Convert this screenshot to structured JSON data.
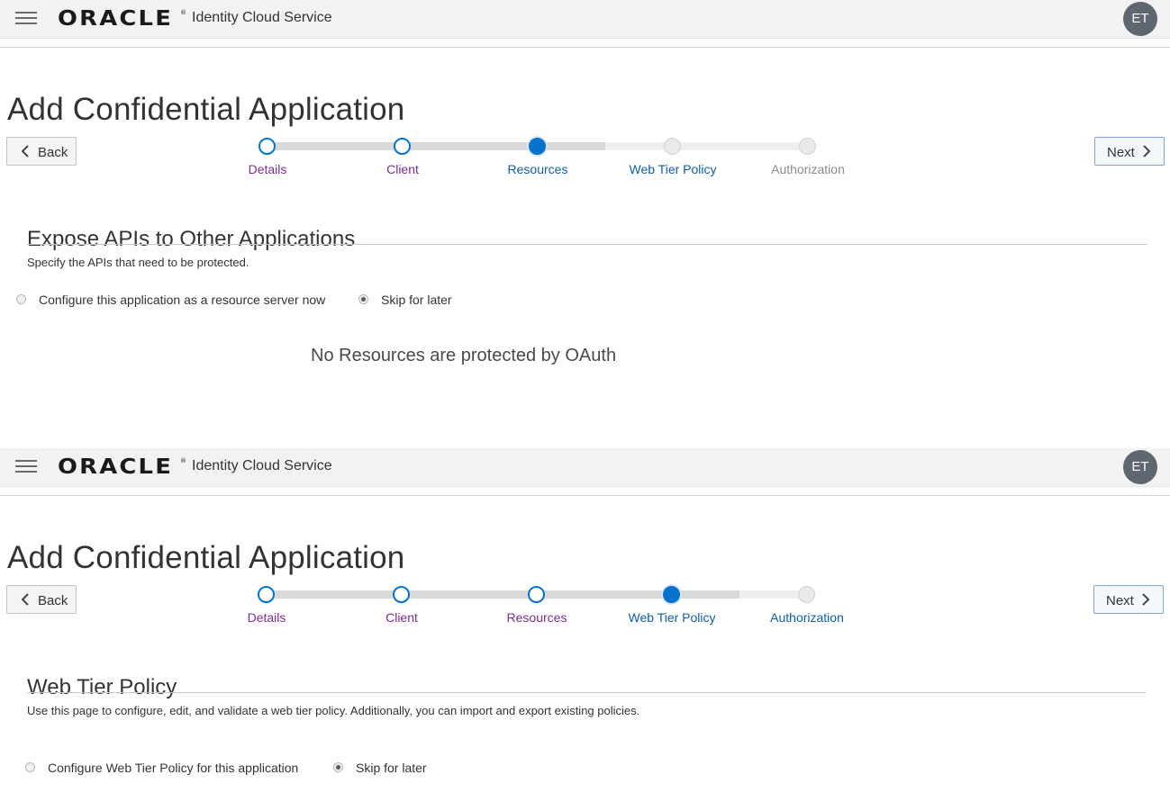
{
  "header": {
    "brand_logo_text": "ORACLE",
    "brand_reg_mark": "®",
    "product_name": "Identity Cloud Service",
    "user_initials": "ET"
  },
  "panels": [
    {
      "page_title": "Add Confidential Application",
      "back_label": "Back",
      "next_label": "Next",
      "train": {
        "steps": [
          {
            "label": "Details",
            "state": "visited"
          },
          {
            "label": "Client",
            "state": "visited"
          },
          {
            "label": "Resources",
            "state": "current"
          },
          {
            "label": "Web Tier Policy",
            "state": "pending"
          },
          {
            "label": "Authorization",
            "state": "pending"
          }
        ]
      },
      "section_title": "Expose APIs to Other Applications",
      "section_description": "Specify the APIs that need to be protected.",
      "options": [
        {
          "label": "Configure this application as a resource server now",
          "selected": false
        },
        {
          "label": "Skip for later",
          "selected": true
        }
      ],
      "empty_message": "No Resources are protected by OAuth"
    },
    {
      "page_title": "Add Confidential Application",
      "back_label": "Back",
      "next_label": "Next",
      "train": {
        "steps": [
          {
            "label": "Details",
            "state": "visited"
          },
          {
            "label": "Client",
            "state": "visited"
          },
          {
            "label": "Resources",
            "state": "visited"
          },
          {
            "label": "Web Tier Policy",
            "state": "current"
          },
          {
            "label": "Authorization",
            "state": "pending"
          }
        ]
      },
      "section_title": "Web Tier Policy",
      "section_description": "Use this page to configure, edit, and validate a web tier policy. Additionally, you can import and export existing policies.",
      "options": [
        {
          "label": "Configure Web Tier Policy for this application",
          "selected": false
        },
        {
          "label": "Skip for later",
          "selected": true
        }
      ]
    }
  ],
  "colors": {
    "accent_blue": "#0572ce",
    "visited_label": "#7a2d8f",
    "current_label": "#0e5ea8",
    "pending_label": "#8a8a8a",
    "header_bg": "#f2f2f2",
    "avatar_bg": "#5f6670"
  }
}
